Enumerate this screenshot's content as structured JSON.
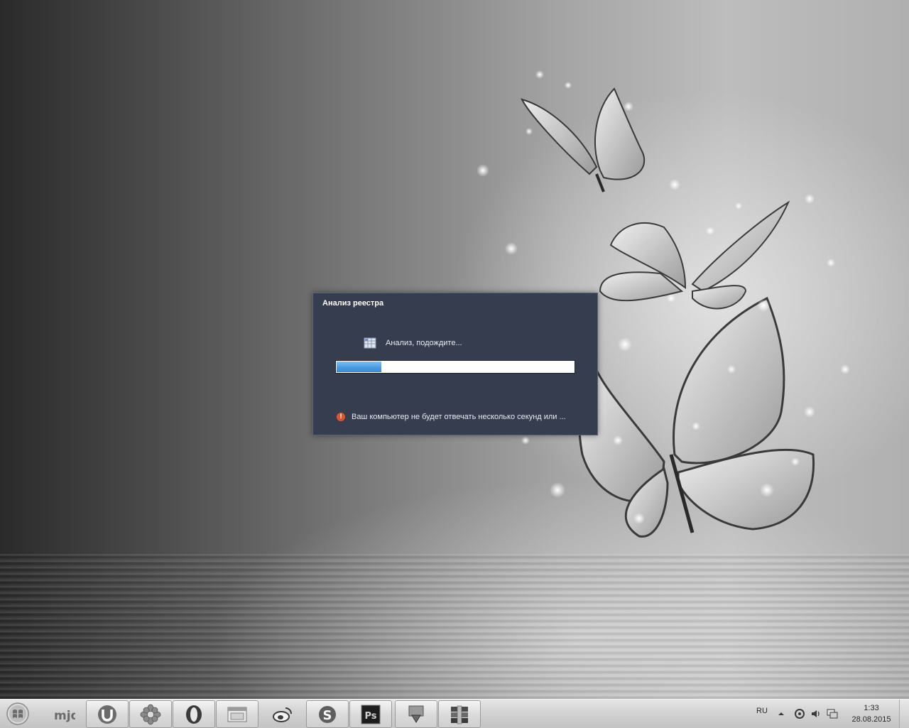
{
  "dialog": {
    "title": "Анализ реестра",
    "status_text": "Анализ, подождите...",
    "progress": 0.19,
    "warning_text": "Ваш компьютер не будет отвечать несколько секунд или ...",
    "background_color": "#363d4f",
    "progress_color": "#4a9be0"
  },
  "taskbar": {
    "buttons": [
      {
        "icon": "windows-start-orb"
      },
      {
        "icon": "mjd-icon"
      },
      {
        "icon": "utorrent-icon"
      },
      {
        "icon": "flower-icon"
      },
      {
        "icon": "opera-icon"
      },
      {
        "icon": "file-manager-icon"
      },
      {
        "icon": "weibo-icon"
      },
      {
        "icon": "skype-icon"
      },
      {
        "icon": "photoshop-icon",
        "label": "Ps"
      },
      {
        "icon": "download-master-icon"
      },
      {
        "icon": "winrar-icon"
      }
    ],
    "tray": {
      "language": "RU",
      "time": "1:33",
      "date": "28.08.2015"
    }
  }
}
